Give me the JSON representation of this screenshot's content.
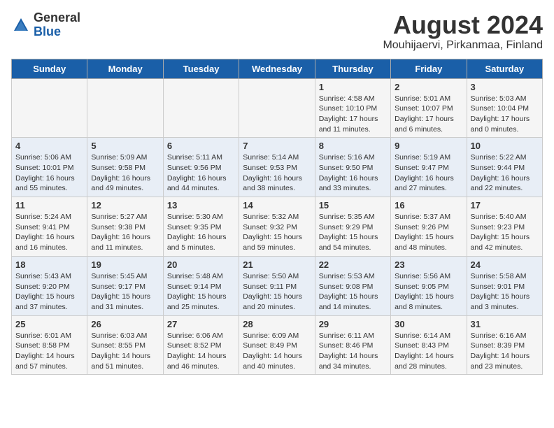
{
  "header": {
    "logo_general": "General",
    "logo_blue": "Blue",
    "title": "August 2024",
    "subtitle": "Mouhijaervi, Pirkanmaa, Finland"
  },
  "weekdays": [
    "Sunday",
    "Monday",
    "Tuesday",
    "Wednesday",
    "Thursday",
    "Friday",
    "Saturday"
  ],
  "weeks": [
    [
      {
        "day": "",
        "info": ""
      },
      {
        "day": "",
        "info": ""
      },
      {
        "day": "",
        "info": ""
      },
      {
        "day": "",
        "info": ""
      },
      {
        "day": "1",
        "info": "Sunrise: 4:58 AM\nSunset: 10:10 PM\nDaylight: 17 hours\nand 11 minutes."
      },
      {
        "day": "2",
        "info": "Sunrise: 5:01 AM\nSunset: 10:07 PM\nDaylight: 17 hours\nand 6 minutes."
      },
      {
        "day": "3",
        "info": "Sunrise: 5:03 AM\nSunset: 10:04 PM\nDaylight: 17 hours\nand 0 minutes."
      }
    ],
    [
      {
        "day": "4",
        "info": "Sunrise: 5:06 AM\nSunset: 10:01 PM\nDaylight: 16 hours\nand 55 minutes."
      },
      {
        "day": "5",
        "info": "Sunrise: 5:09 AM\nSunset: 9:58 PM\nDaylight: 16 hours\nand 49 minutes."
      },
      {
        "day": "6",
        "info": "Sunrise: 5:11 AM\nSunset: 9:56 PM\nDaylight: 16 hours\nand 44 minutes."
      },
      {
        "day": "7",
        "info": "Sunrise: 5:14 AM\nSunset: 9:53 PM\nDaylight: 16 hours\nand 38 minutes."
      },
      {
        "day": "8",
        "info": "Sunrise: 5:16 AM\nSunset: 9:50 PM\nDaylight: 16 hours\nand 33 minutes."
      },
      {
        "day": "9",
        "info": "Sunrise: 5:19 AM\nSunset: 9:47 PM\nDaylight: 16 hours\nand 27 minutes."
      },
      {
        "day": "10",
        "info": "Sunrise: 5:22 AM\nSunset: 9:44 PM\nDaylight: 16 hours\nand 22 minutes."
      }
    ],
    [
      {
        "day": "11",
        "info": "Sunrise: 5:24 AM\nSunset: 9:41 PM\nDaylight: 16 hours\nand 16 minutes."
      },
      {
        "day": "12",
        "info": "Sunrise: 5:27 AM\nSunset: 9:38 PM\nDaylight: 16 hours\nand 11 minutes."
      },
      {
        "day": "13",
        "info": "Sunrise: 5:30 AM\nSunset: 9:35 PM\nDaylight: 16 hours\nand 5 minutes."
      },
      {
        "day": "14",
        "info": "Sunrise: 5:32 AM\nSunset: 9:32 PM\nDaylight: 15 hours\nand 59 minutes."
      },
      {
        "day": "15",
        "info": "Sunrise: 5:35 AM\nSunset: 9:29 PM\nDaylight: 15 hours\nand 54 minutes."
      },
      {
        "day": "16",
        "info": "Sunrise: 5:37 AM\nSunset: 9:26 PM\nDaylight: 15 hours\nand 48 minutes."
      },
      {
        "day": "17",
        "info": "Sunrise: 5:40 AM\nSunset: 9:23 PM\nDaylight: 15 hours\nand 42 minutes."
      }
    ],
    [
      {
        "day": "18",
        "info": "Sunrise: 5:43 AM\nSunset: 9:20 PM\nDaylight: 15 hours\nand 37 minutes."
      },
      {
        "day": "19",
        "info": "Sunrise: 5:45 AM\nSunset: 9:17 PM\nDaylight: 15 hours\nand 31 minutes."
      },
      {
        "day": "20",
        "info": "Sunrise: 5:48 AM\nSunset: 9:14 PM\nDaylight: 15 hours\nand 25 minutes."
      },
      {
        "day": "21",
        "info": "Sunrise: 5:50 AM\nSunset: 9:11 PM\nDaylight: 15 hours\nand 20 minutes."
      },
      {
        "day": "22",
        "info": "Sunrise: 5:53 AM\nSunset: 9:08 PM\nDaylight: 15 hours\nand 14 minutes."
      },
      {
        "day": "23",
        "info": "Sunrise: 5:56 AM\nSunset: 9:05 PM\nDaylight: 15 hours\nand 8 minutes."
      },
      {
        "day": "24",
        "info": "Sunrise: 5:58 AM\nSunset: 9:01 PM\nDaylight: 15 hours\nand 3 minutes."
      }
    ],
    [
      {
        "day": "25",
        "info": "Sunrise: 6:01 AM\nSunset: 8:58 PM\nDaylight: 14 hours\nand 57 minutes."
      },
      {
        "day": "26",
        "info": "Sunrise: 6:03 AM\nSunset: 8:55 PM\nDaylight: 14 hours\nand 51 minutes."
      },
      {
        "day": "27",
        "info": "Sunrise: 6:06 AM\nSunset: 8:52 PM\nDaylight: 14 hours\nand 46 minutes."
      },
      {
        "day": "28",
        "info": "Sunrise: 6:09 AM\nSunset: 8:49 PM\nDaylight: 14 hours\nand 40 minutes."
      },
      {
        "day": "29",
        "info": "Sunrise: 6:11 AM\nSunset: 8:46 PM\nDaylight: 14 hours\nand 34 minutes."
      },
      {
        "day": "30",
        "info": "Sunrise: 6:14 AM\nSunset: 8:43 PM\nDaylight: 14 hours\nand 28 minutes."
      },
      {
        "day": "31",
        "info": "Sunrise: 6:16 AM\nSunset: 8:39 PM\nDaylight: 14 hours\nand 23 minutes."
      }
    ]
  ]
}
